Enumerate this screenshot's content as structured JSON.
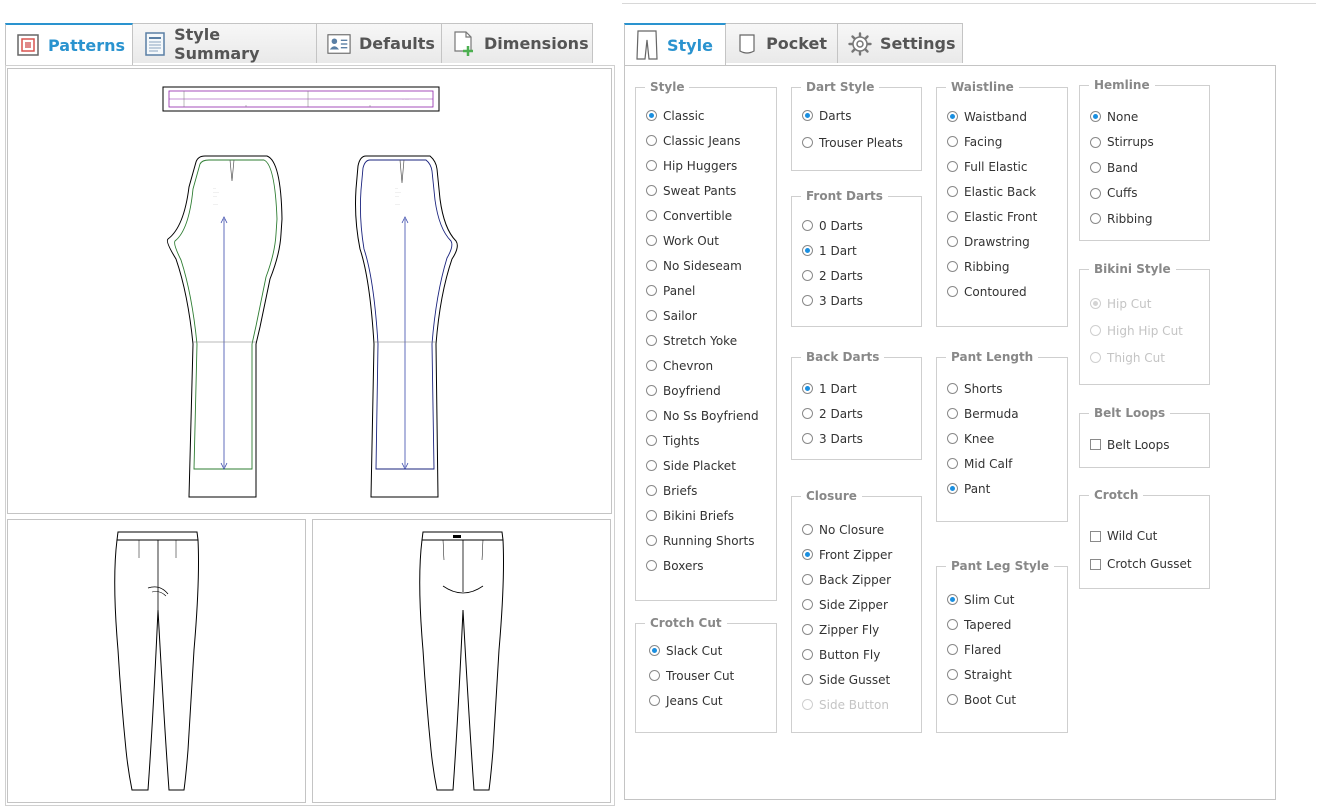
{
  "left_tabs": [
    {
      "label": "Patterns",
      "icon": "patterns-icon",
      "active": true
    },
    {
      "label": "Style Summary",
      "icon": "document-icon",
      "active": false
    },
    {
      "label": "Defaults",
      "icon": "user-card-icon",
      "active": false
    },
    {
      "label": "Dimensions",
      "icon": "add-document-icon",
      "active": false
    }
  ],
  "right_tabs": [
    {
      "label": "Style",
      "icon": "pants-icon",
      "active": true
    },
    {
      "label": "Pocket",
      "icon": "pocket-icon",
      "active": false
    },
    {
      "label": "Settings",
      "icon": "gear-icon",
      "active": false
    }
  ],
  "groups": {
    "style": {
      "legend": "Style",
      "options": [
        {
          "label": "Classic",
          "checked": true
        },
        {
          "label": "Classic Jeans"
        },
        {
          "label": "Hip Huggers"
        },
        {
          "label": "Sweat Pants"
        },
        {
          "label": "Convertible"
        },
        {
          "label": "Work Out"
        },
        {
          "label": "No Sideseam"
        },
        {
          "label": "Panel"
        },
        {
          "label": "Sailor"
        },
        {
          "label": "Stretch Yoke"
        },
        {
          "label": "Chevron"
        },
        {
          "label": "Boyfriend"
        },
        {
          "label": "No Ss Boyfriend"
        },
        {
          "label": "Tights"
        },
        {
          "label": "Side Placket"
        },
        {
          "label": "Briefs"
        },
        {
          "label": "Bikini Briefs"
        },
        {
          "label": "Running Shorts"
        },
        {
          "label": "Boxers"
        }
      ]
    },
    "crotch_cut": {
      "legend": "Crotch Cut",
      "options": [
        {
          "label": "Slack Cut",
          "checked": true
        },
        {
          "label": "Trouser Cut"
        },
        {
          "label": "Jeans Cut"
        }
      ]
    },
    "dart_style": {
      "legend": "Dart Style",
      "options": [
        {
          "label": "Darts",
          "checked": true
        },
        {
          "label": "Trouser Pleats"
        }
      ]
    },
    "front_darts": {
      "legend": "Front Darts",
      "options": [
        {
          "label": "0 Darts"
        },
        {
          "label": "1 Dart",
          "checked": true
        },
        {
          "label": "2 Darts"
        },
        {
          "label": "3 Darts"
        }
      ]
    },
    "back_darts": {
      "legend": "Back Darts",
      "options": [
        {
          "label": "1 Dart",
          "checked": true
        },
        {
          "label": "2 Darts"
        },
        {
          "label": "3 Darts"
        }
      ]
    },
    "closure": {
      "legend": "Closure",
      "options": [
        {
          "label": "No Closure"
        },
        {
          "label": "Front Zipper",
          "checked": true
        },
        {
          "label": "Back Zipper"
        },
        {
          "label": "Side Zipper"
        },
        {
          "label": "Zipper Fly"
        },
        {
          "label": "Button Fly"
        },
        {
          "label": "Side Gusset"
        },
        {
          "label": "Side Button",
          "disabled": true
        }
      ]
    },
    "waistline": {
      "legend": "Waistline",
      "options": [
        {
          "label": "Waistband",
          "checked": true
        },
        {
          "label": "Facing"
        },
        {
          "label": "Full Elastic"
        },
        {
          "label": "Elastic Back"
        },
        {
          "label": "Elastic Front"
        },
        {
          "label": "Drawstring"
        },
        {
          "label": "Ribbing"
        },
        {
          "label": "Contoured"
        }
      ]
    },
    "pant_length": {
      "legend": "Pant Length",
      "options": [
        {
          "label": "Shorts"
        },
        {
          "label": "Bermuda"
        },
        {
          "label": "Knee"
        },
        {
          "label": "Mid Calf"
        },
        {
          "label": "Pant",
          "checked": true
        }
      ]
    },
    "pant_leg_style": {
      "legend": "Pant Leg Style",
      "options": [
        {
          "label": "Slim Cut",
          "checked": true
        },
        {
          "label": "Tapered"
        },
        {
          "label": "Flared"
        },
        {
          "label": "Straight"
        },
        {
          "label": "Boot Cut"
        }
      ]
    },
    "hemline": {
      "legend": "Hemline",
      "options": [
        {
          "label": "None",
          "checked": true
        },
        {
          "label": "Stirrups"
        },
        {
          "label": "Band"
        },
        {
          "label": "Cuffs"
        },
        {
          "label": "Ribbing"
        }
      ]
    },
    "bikini_style": {
      "legend": "Bikini Style",
      "options": [
        {
          "label": "Hip Cut",
          "checked": true,
          "disabled": true
        },
        {
          "label": "High Hip Cut",
          "disabled": true
        },
        {
          "label": "Thigh Cut",
          "disabled": true
        }
      ]
    },
    "belt_loops": {
      "legend": "Belt Loops",
      "options": [
        {
          "label": "Belt Loops",
          "type": "checkbox"
        }
      ]
    },
    "crotch": {
      "legend": "Crotch",
      "options": [
        {
          "label": "Wild Cut",
          "type": "checkbox"
        },
        {
          "label": "Crotch Gusset",
          "type": "checkbox"
        }
      ]
    }
  },
  "colors": {
    "accent": "#2a93cf",
    "radio_selected": "#1a8fe0",
    "front_outline": "#2e7d32",
    "back_outline": "#1a237e",
    "grain_line": "#3949ab",
    "waistband_line": "#8e24aa"
  }
}
